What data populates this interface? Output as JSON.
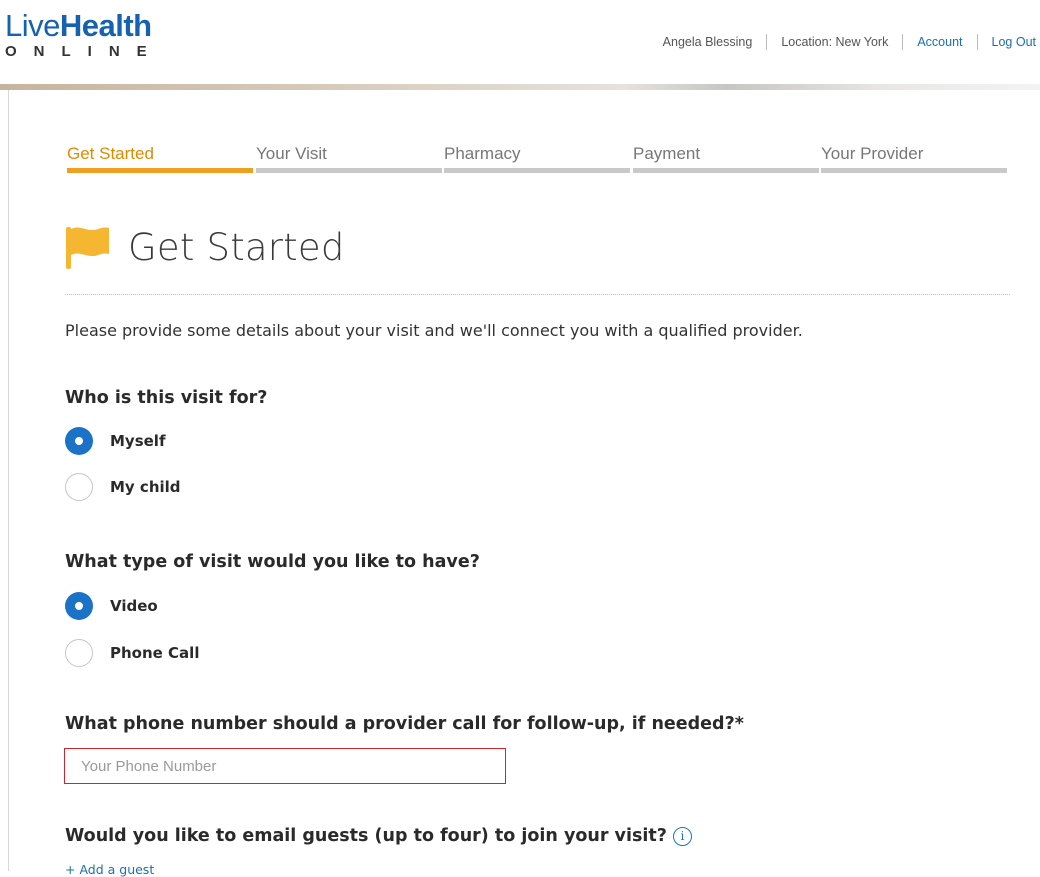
{
  "brand": {
    "logo_line1_light": "Live",
    "logo_line1_bold": "Health",
    "logo_line2": "ONLINE"
  },
  "topnav": {
    "user_name": "Angela Blessing",
    "location": "Location: New York",
    "account": "Account",
    "logout": "Log Out"
  },
  "steps": [
    {
      "label": "Get Started",
      "active": true
    },
    {
      "label": "Your Visit",
      "active": false
    },
    {
      "label": "Pharmacy",
      "active": false
    },
    {
      "label": "Payment",
      "active": false
    },
    {
      "label": "Your Provider",
      "active": false
    }
  ],
  "page": {
    "title": "Get Started",
    "title_icon": "flag-icon",
    "intro": "Please provide some details about your visit and we'll connect you with a qualified provider."
  },
  "visit_for": {
    "question": "Who is this visit for?",
    "options": [
      {
        "label": "Myself",
        "selected": true
      },
      {
        "label": "My child",
        "selected": false
      }
    ]
  },
  "visit_type": {
    "question": "What type of visit would you like to have?",
    "options": [
      {
        "label": "Video",
        "selected": true
      },
      {
        "label": "Phone Call",
        "selected": false
      }
    ]
  },
  "phone": {
    "question": "What phone number should a provider call for follow-up, if needed?*",
    "value": "",
    "placeholder": "Your Phone Number"
  },
  "guests": {
    "question": "Would you like to email guests (up to four) to join your visit?",
    "info_icon": "info-icon",
    "add_link": "+ Add a guest"
  },
  "colors": {
    "brand_blue": "#1662b0",
    "link_blue": "#1a6fb5",
    "radio_blue": "#1a73c6",
    "active_step": "#e08a00",
    "active_step_bar": "#f0a020",
    "inactive_step_bar": "#c9c9c9",
    "flag": "#f5b731",
    "error_border": "#d0262b"
  }
}
